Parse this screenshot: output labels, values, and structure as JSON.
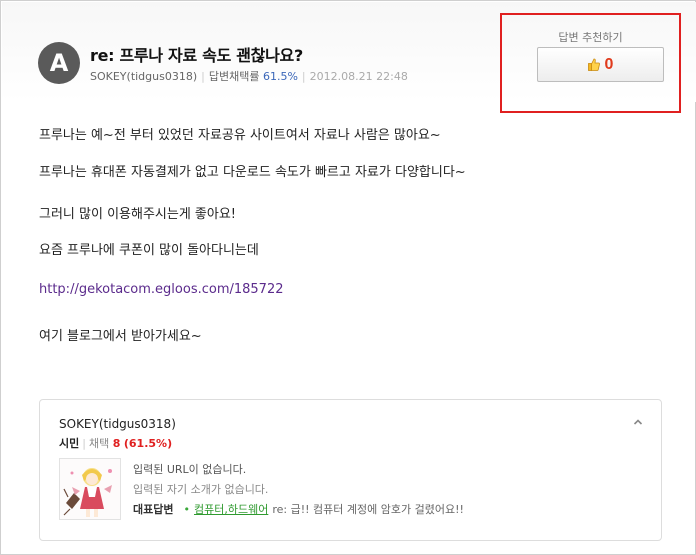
{
  "question": {
    "avatar_letter": "A",
    "title": "re: 프루나 자료 속도 괜찮나요?",
    "author": "SOKEY(tidgus0318)",
    "adopt_rate_label": "답변채택률",
    "adopt_rate_value": "61.5%",
    "date": "2012.08.21 22:48"
  },
  "recommend": {
    "label": "답변 추천하기",
    "count": "0",
    "icon": "thumbs-up-icon",
    "highlight_color": "#e02020"
  },
  "answer": {
    "paragraphs": [
      "프루나는 예~전 부터 있었던 자료공유 사이트여서 자료나 사람은 많아요~",
      "프루나는 휴대폰 자동결제가 없고 다운로드 속도가 빠르고 자료가 다양합니다~",
      "그러니 많이 이용해주시는게 좋아요!",
      "요즘 프루나에 쿠폰이 많이 돌아다니는데"
    ],
    "link": "http://gekotacom.egloos.com/185722",
    "closing": "여기 블로그에서 받아가세요~"
  },
  "profile": {
    "name": "SOKEY(tidgus0318)",
    "grade": "시민",
    "adopt_label": "채택",
    "adopt_count": "8",
    "adopt_pct": "(61.5%)",
    "url_info": "입력된 URL이 없습니다.",
    "intro_info": "입력된 자기 소개가 없습니다.",
    "rep_label": "대표답변",
    "rep_category": "컴퓨터,하드웨어",
    "rep_text": "re: 급!! 컴퓨터 계정에 암호가 걸렸어요!!"
  }
}
